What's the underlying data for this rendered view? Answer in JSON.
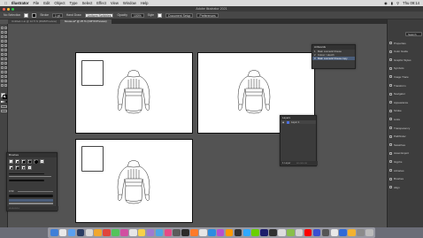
{
  "menubar": {
    "app": "Illustrator",
    "items": [
      "File",
      "Edit",
      "Object",
      "Type",
      "Select",
      "Effect",
      "View",
      "Window",
      "Help"
    ],
    "clock": "Thu 09:14"
  },
  "window_title": "Adobe Illustrator 2021",
  "control_bar": {
    "selection_label": "No Selection",
    "stroke_label": "Stroke",
    "stroke_value": "1 pt",
    "brush_label": "Hand Draw",
    "brush_field": "Uniform Scribbles",
    "opacity_label": "Opacity",
    "opacity_value": "100%",
    "style_label": "Style",
    "doc_setup": "Document Setup",
    "preferences": "Preferences"
  },
  "tabs": [
    {
      "label": "Untitled-1.ai @ 12.5 % (RGB/Preview)",
      "active": false
    },
    {
      "label": "blouse.ai* @ 25 % (CMYK/Preview)",
      "active": true
    }
  ],
  "right_panel": {
    "search_label": "Search",
    "items": [
      "Properties",
      "Color Guide",
      "Graphic Styles",
      "Symbols",
      "Image Trace",
      "Transform",
      "Navigator",
      "Appearance",
      "Stroke",
      "Links",
      "Transparency",
      "Pathfinder",
      "Swatches",
      "Asset Export",
      "Glyphs",
      "Libraries",
      "Brushes",
      "Align"
    ]
  },
  "artboards_panel": {
    "title": "Artboards",
    "rows": [
      {
        "num": "1",
        "label": "Main cosmetic blouse",
        "selected": false
      },
      {
        "num": "2",
        "label": "Colour / sketch",
        "selected": false
      },
      {
        "num": "3",
        "label": "Main cosmetic blouse copy",
        "selected": true
      }
    ]
  },
  "layers_panel": {
    "title": "Layers",
    "layer_name": "Layer 1",
    "footer": "1 Layer"
  },
  "brushes_panel": {
    "title": "Brushes",
    "size_label": "0.50"
  },
  "dock": {
    "colors": [
      "#3f7fd8",
      "#e9e9e9",
      "#5aa0f0",
      "#2b3d63",
      "#d8d8d8",
      "#f0a72e",
      "#e0453c",
      "#53c45a",
      "#d14fa1",
      "#e6e6e6",
      "#f7d248",
      "#9f7bd1",
      "#4ca7e4",
      "#e64a86",
      "#5b5b5b",
      "#2a2a2a",
      "#ff7a2a",
      "#e5e5e5",
      "#2c8de0",
      "#b64fd1",
      "#ff9a00",
      "#333333",
      "#31a8ff",
      "#6ad000",
      "#1d1d6b",
      "#303030",
      "#dddddd",
      "#89bf4a",
      "#d3d3d3",
      "#ff0000",
      "#3b4fd1",
      "#555555",
      "#e8e8e8",
      "#2f6ad8",
      "#f3b22f",
      "#8b8b8b",
      "#bbbbbb"
    ]
  }
}
